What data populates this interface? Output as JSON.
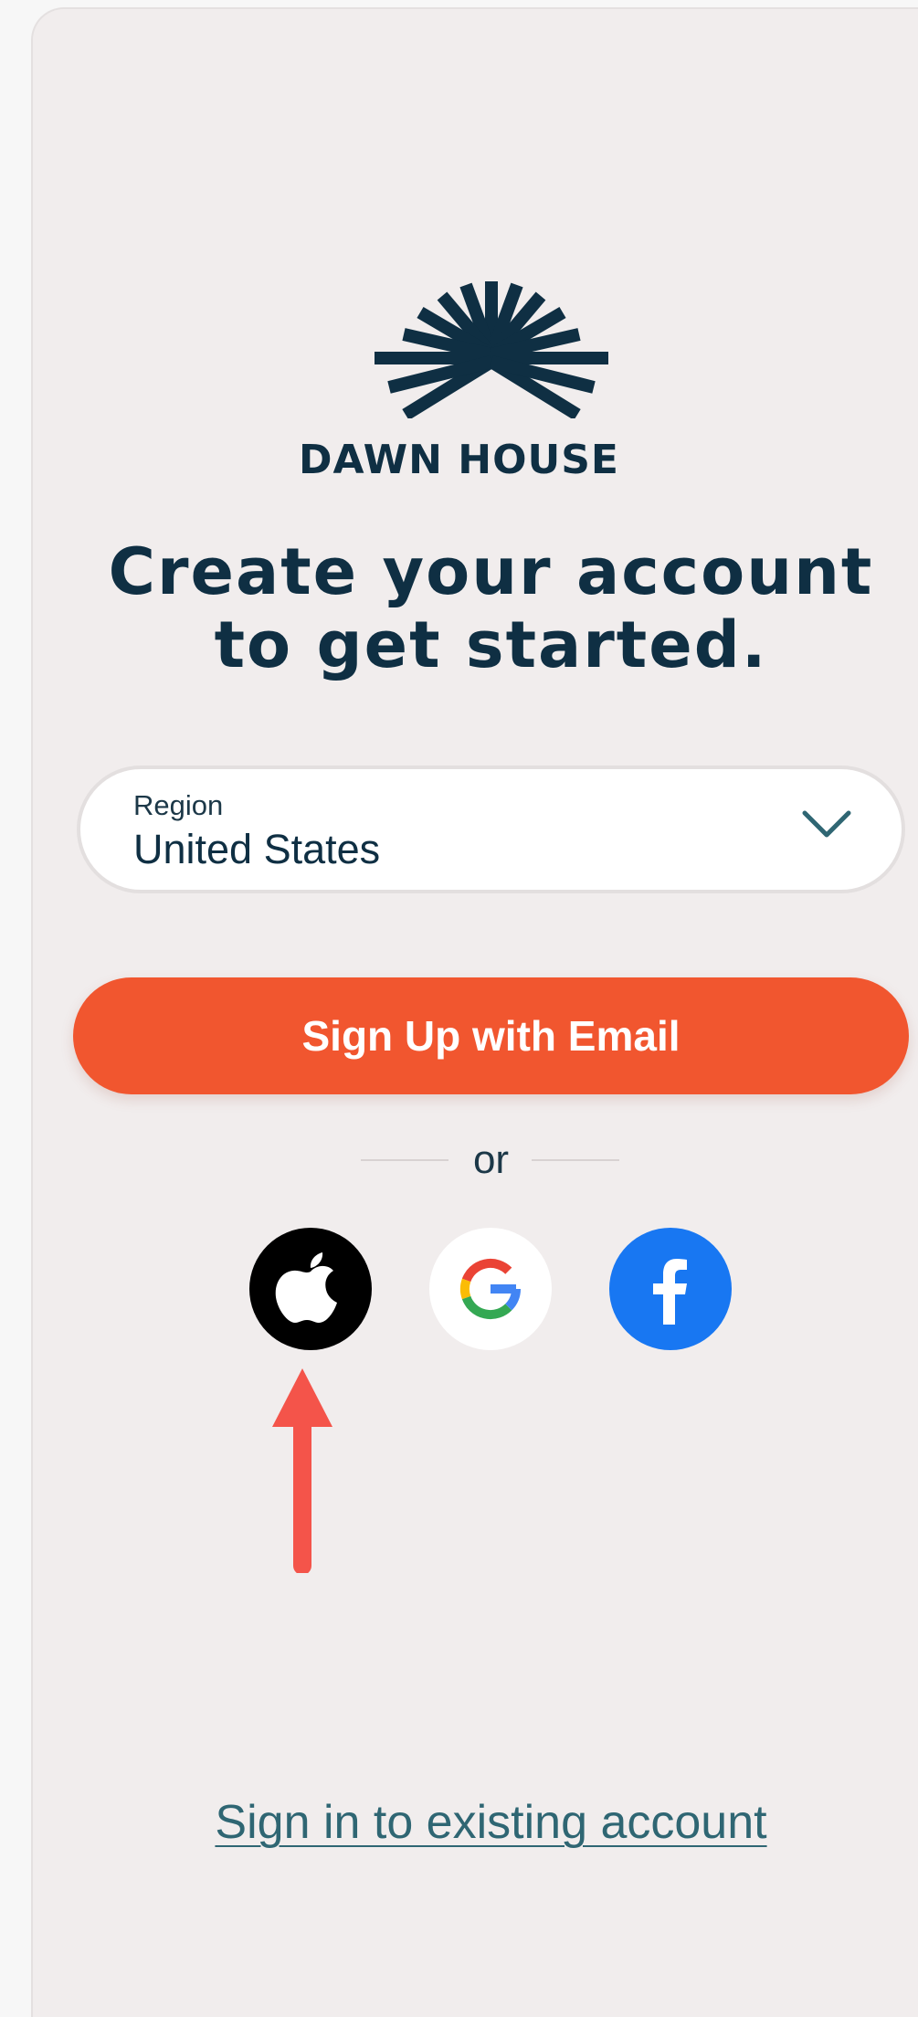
{
  "brand": {
    "name": "DAWN HOUSE",
    "logo_icon": "sunrise-logo-icon"
  },
  "headline": {
    "line1": "Create your account",
    "line2": "to get started."
  },
  "region": {
    "label": "Region",
    "value": "United States",
    "icon": "chevron-down-icon"
  },
  "email_button": {
    "label": "Sign Up with Email",
    "color": "#f1562f"
  },
  "divider": {
    "text": "or"
  },
  "social": [
    {
      "name": "Apple",
      "icon": "apple-icon",
      "color": "#000000"
    },
    {
      "name": "Google",
      "icon": "google-icon",
      "color": "#ffffff"
    },
    {
      "name": "Facebook",
      "icon": "facebook-icon",
      "color": "#1877f2"
    }
  ],
  "annotation": {
    "icon": "red-arrow-icon",
    "color": "#f4544a"
  },
  "signin_link": {
    "label": "Sign in to existing account"
  },
  "colors": {
    "background": "#f1eded",
    "text_primary": "#0f2f43",
    "link": "#2f6673"
  }
}
